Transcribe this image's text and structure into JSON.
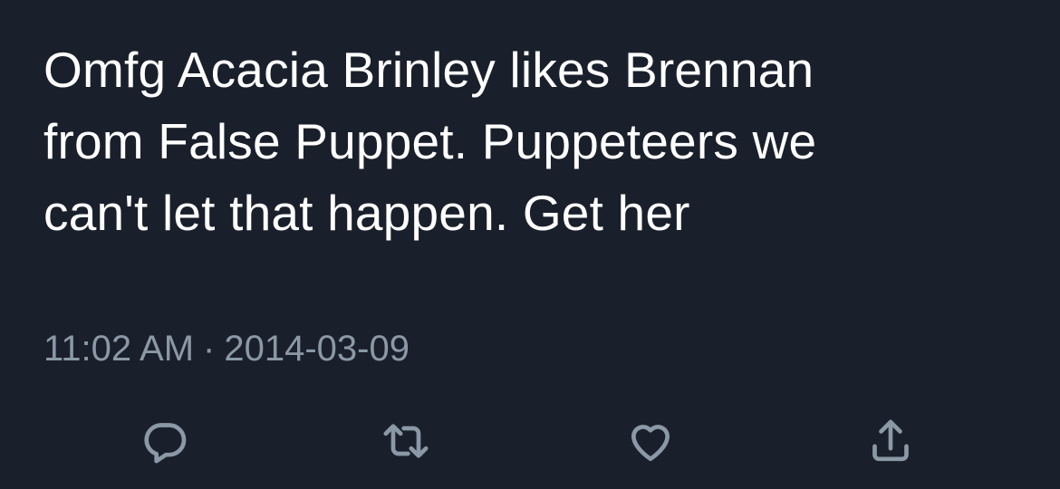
{
  "tweet": {
    "text_lines": [
      "Omfg Acacia Brinley likes Brennan",
      "from False Puppet. Puppeteers we",
      "can't let that happen. Get her"
    ],
    "time": "11:02 AM",
    "separator": "·",
    "date": "2014-03-09"
  },
  "actions": {
    "reply_icon": "reply-icon",
    "retweet_icon": "retweet-icon",
    "like_icon": "heart-icon",
    "share_icon": "share-icon"
  },
  "colors": {
    "background": "#1a202b",
    "text": "#ffffff",
    "secondary": "#8b98a5"
  }
}
